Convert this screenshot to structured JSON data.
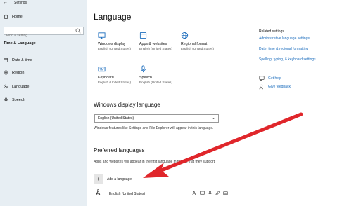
{
  "window": {
    "app_title": "Settings",
    "back_glyph": "←",
    "minimize_glyph": "—",
    "maximize_glyph": "☐",
    "close_glyph": "✕"
  },
  "sidebar": {
    "home_label": "Home",
    "search_placeholder": "Find a setting",
    "section_title": "Time & Language",
    "items": [
      {
        "label": "Date & time",
        "icon": "calendar-clock-icon"
      },
      {
        "label": "Region",
        "icon": "globe-icon"
      },
      {
        "label": "Language",
        "icon": "language-icon"
      },
      {
        "label": "Speech",
        "icon": "microphone-icon"
      }
    ]
  },
  "main": {
    "title": "Language",
    "tiles": [
      {
        "name": "Windows display",
        "sub": "English (United States)",
        "icon": "monitor-icon"
      },
      {
        "name": "Apps & websites",
        "sub": "English (United States)",
        "icon": "window-icon"
      },
      {
        "name": "Regional format",
        "sub": "English (United States)",
        "icon": "globe-icon"
      },
      {
        "name": "Keyboard",
        "sub": "English (United States)",
        "icon": "keyboard-icon"
      },
      {
        "name": "Speech",
        "sub": "English (United States)",
        "icon": "microphone-icon"
      }
    ],
    "related": {
      "heading": "Related settings",
      "links": [
        "Administrative language settings",
        "Date, time & regional formatting",
        "Spelling, typing, & keyboard settings"
      ],
      "get_help": "Get help",
      "give_feedback": "Give feedback"
    },
    "display_language": {
      "heading": "Windows display language",
      "selected": "English (United States)",
      "description": "Windows features like Settings and File Explorer will appear in this language."
    },
    "preferred": {
      "heading": "Preferred languages",
      "description": "Apps and websites will appear in the first language in the list that they support.",
      "add_label": "Add a language",
      "languages": [
        {
          "name": "English (United States)"
        }
      ]
    }
  },
  "colors": {
    "sidebar_bg": "#e7eef3",
    "accent": "#1f6fbe",
    "annotation_arrow": "#e0262b"
  }
}
